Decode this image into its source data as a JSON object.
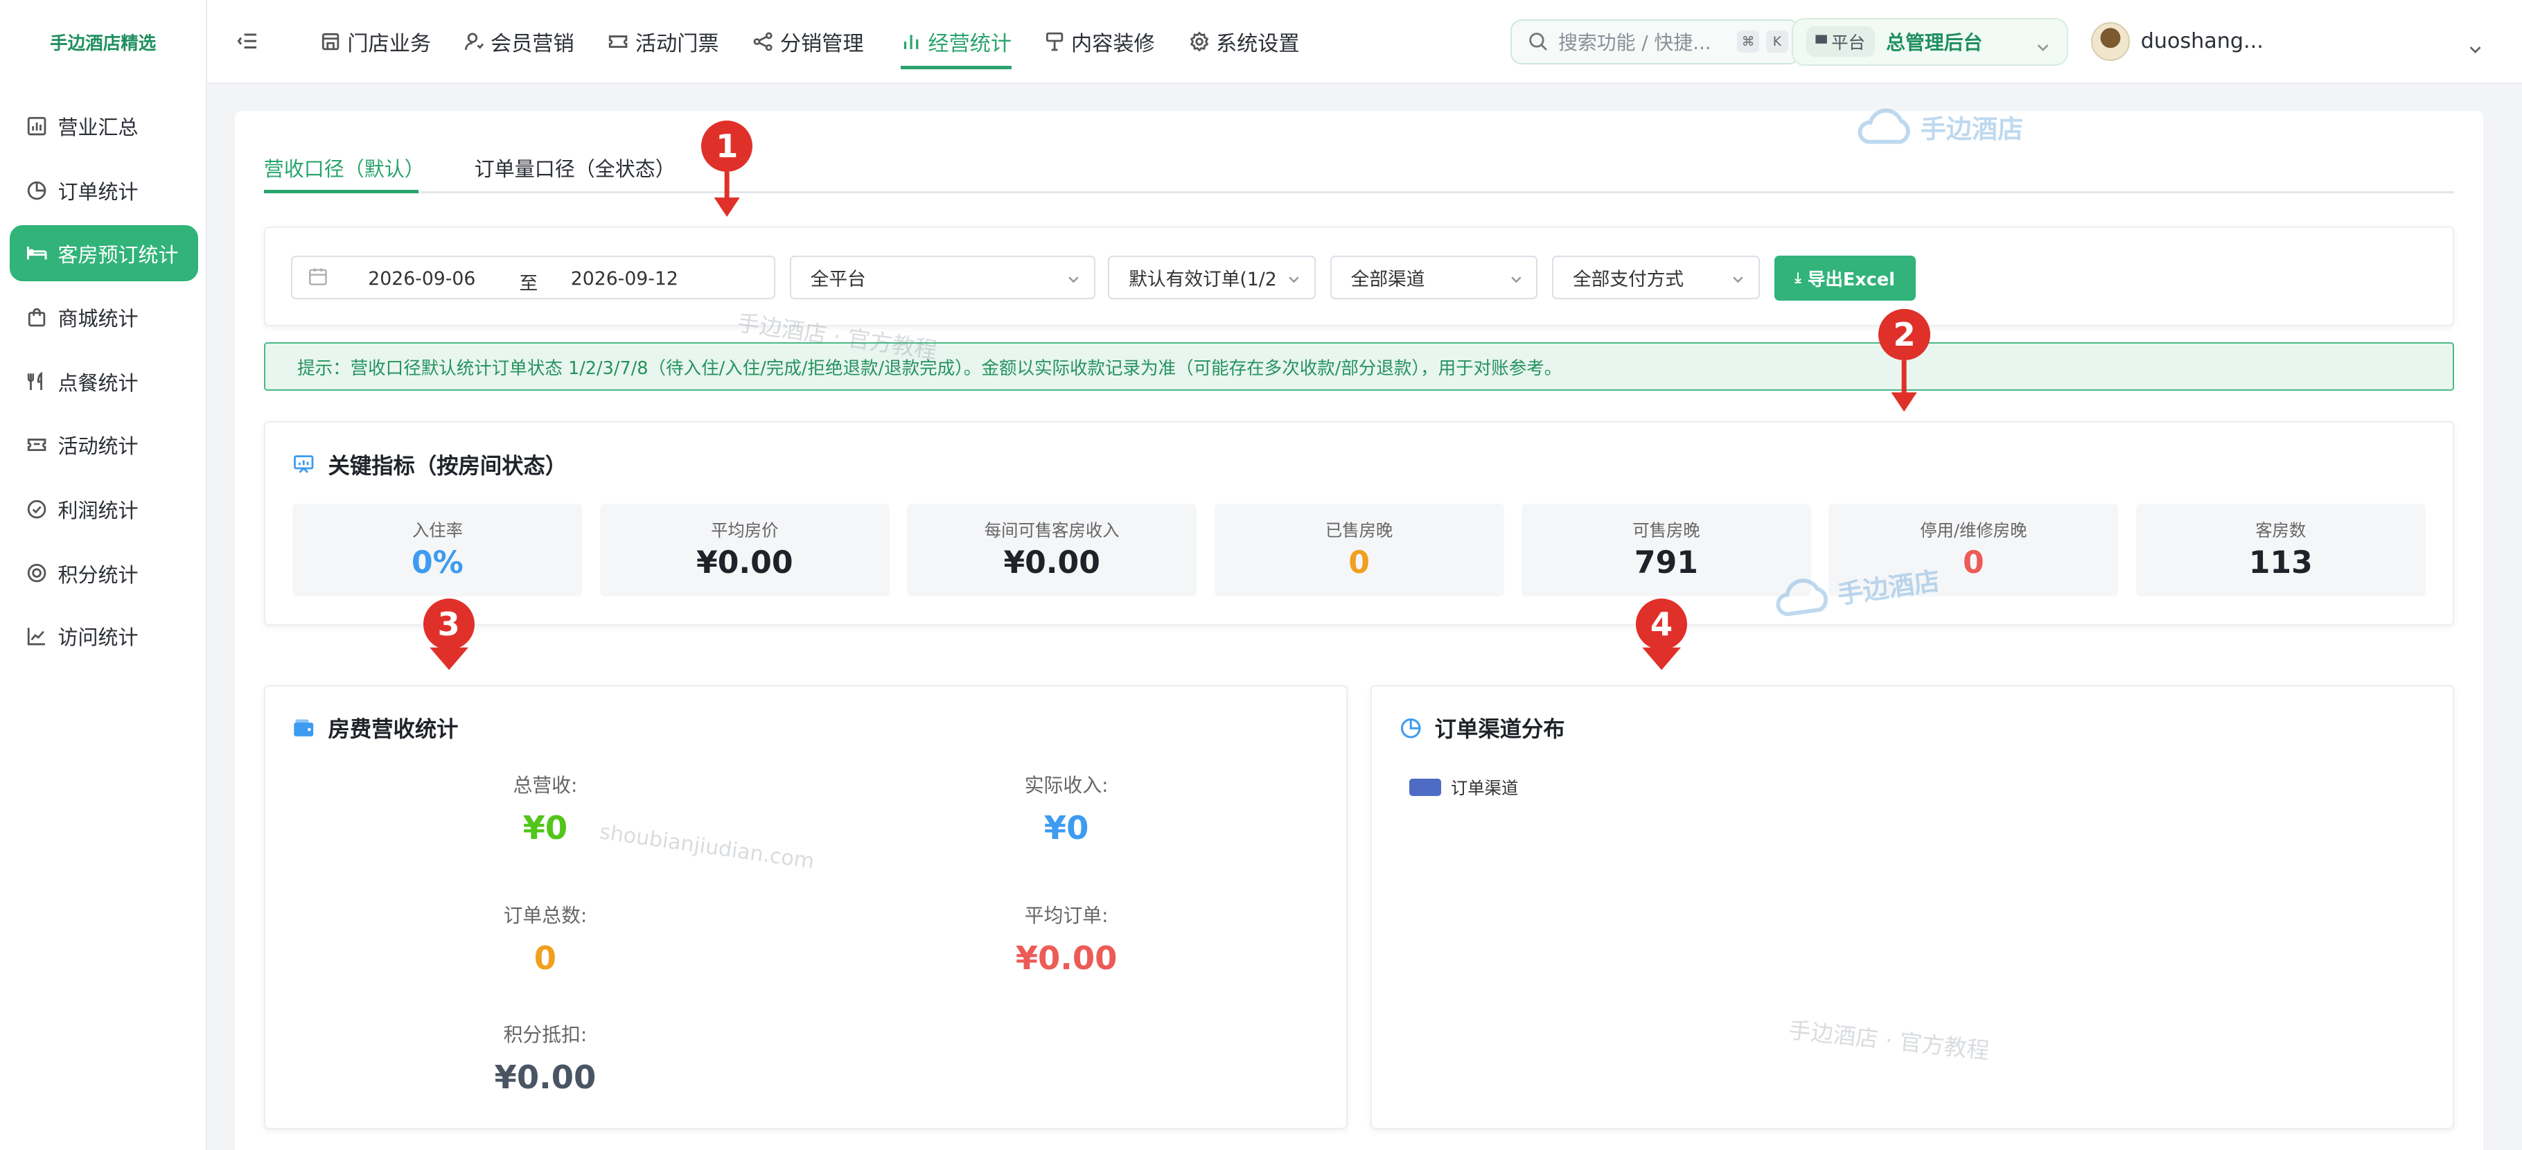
{
  "brand": "手边酒店精选",
  "sidebar": {
    "items": [
      {
        "label": "营业汇总",
        "icon": "bar-chart-icon"
      },
      {
        "label": "订单统计",
        "icon": "pie-icon"
      },
      {
        "label": "客房预订统计",
        "icon": "bed-icon"
      },
      {
        "label": "商城统计",
        "icon": "bag-icon"
      },
      {
        "label": "点餐统计",
        "icon": "fork-knife-icon"
      },
      {
        "label": "活动统计",
        "icon": "ticket-icon"
      },
      {
        "label": "利润统计",
        "icon": "check-circle-icon"
      },
      {
        "label": "积分统计",
        "icon": "coin-icon"
      },
      {
        "label": "访问统计",
        "icon": "line-chart-icon"
      }
    ],
    "active_index": 2
  },
  "topnav": {
    "items": [
      {
        "label": "门店业务",
        "icon": "store-icon"
      },
      {
        "label": "会员营销",
        "icon": "user-icon"
      },
      {
        "label": "活动门票",
        "icon": "ticket-icon"
      },
      {
        "label": "分销管理",
        "icon": "share-icon"
      },
      {
        "label": "经营统计",
        "icon": "bar-chart-icon"
      },
      {
        "label": "内容装修",
        "icon": "brush-icon"
      },
      {
        "label": "系统设置",
        "icon": "gear-icon"
      }
    ],
    "active_index": 4,
    "search_placeholder": "搜索功能 / 快捷...",
    "shortcut_keys": [
      "⌘",
      "K"
    ],
    "platform_tag": "平台",
    "platform_value": "总管理后台",
    "username": "duoshang..."
  },
  "tabs": [
    {
      "label": "营收口径（默认）"
    },
    {
      "label": "订单量口径（全状态）"
    }
  ],
  "filters": {
    "date_start": "2026-09-06",
    "date_sep": "至",
    "date_end": "2026-09-12",
    "platform": "全平台",
    "order_status": "默认有效订单(1/2",
    "channel": "全部渠道",
    "payment": "全部支付方式",
    "export_label": "导出Excel"
  },
  "tip": "提示：营收口径默认统计订单状态 1/2/3/7/8（待入住/入住/完成/拒绝退款/退款完成）。金额以实际收款记录为准（可能存在多次收款/部分退款），用于对账参考。",
  "kpi": {
    "title": "关键指标（按房间状态）",
    "items": [
      {
        "label": "入住率",
        "value": "0%",
        "color": "#3d9bf0"
      },
      {
        "label": "平均房价",
        "value": "¥0.00",
        "color": "#1f2329"
      },
      {
        "label": "每间可售客房收入",
        "value": "¥0.00",
        "color": "#1f2329"
      },
      {
        "label": "已售房晚",
        "value": "0",
        "color": "#f0a020"
      },
      {
        "label": "可售房晚",
        "value": "791",
        "color": "#1f2329"
      },
      {
        "label": "停用/维修房晚",
        "value": "0",
        "color": "#ec5b56"
      },
      {
        "label": "客房数",
        "value": "113",
        "color": "#1f2329"
      }
    ]
  },
  "revenue": {
    "title": "房费营收统计",
    "stats": [
      {
        "label": "总营收:",
        "value": "¥0",
        "color": "#52c41a"
      },
      {
        "label": "实际收入:",
        "value": "¥0",
        "color": "#3d9bf0"
      },
      {
        "label": "订单总数:",
        "value": "0",
        "color": "#f0a020"
      },
      {
        "label": "平均订单:",
        "value": "¥0.00",
        "color": "#ec5b56"
      },
      {
        "label": "积分抵扣:",
        "value": "¥0.00",
        "color": "#4a5563"
      }
    ]
  },
  "channel": {
    "title": "订单渠道分布",
    "legend": "订单渠道",
    "legend_color": "#4e6cc6"
  },
  "watermarks": {
    "logo_text": "手边酒店",
    "text1": "手边酒店 · 官方教程",
    "text2": "shoubianjiudian.com",
    "text3": "手边酒店 · 官方教程"
  },
  "markers": [
    "1",
    "2",
    "3",
    "4"
  ]
}
